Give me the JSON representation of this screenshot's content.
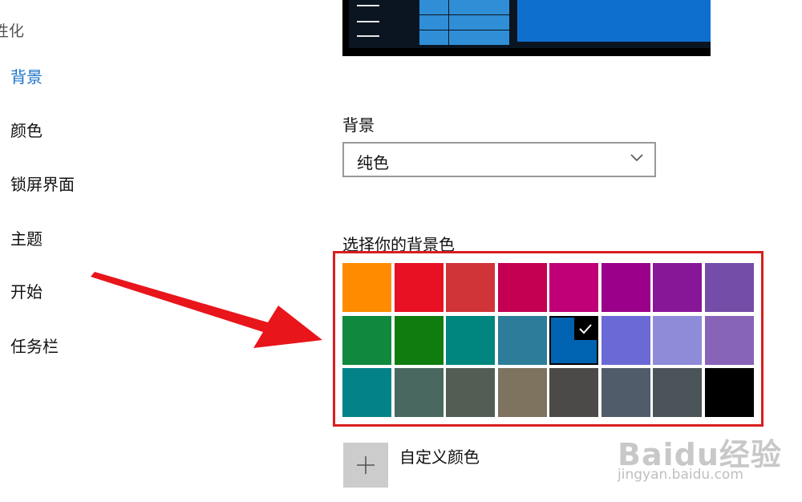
{
  "sidebar": {
    "section_title": "性化",
    "items": [
      {
        "label": "背景",
        "active": true
      },
      {
        "label": "颜色"
      },
      {
        "label": "锁屏界面"
      },
      {
        "label": "主题"
      },
      {
        "label": "开始"
      },
      {
        "label": "任务栏"
      }
    ]
  },
  "main": {
    "background_label": "背景",
    "background_dropdown": {
      "selected": "纯色",
      "icon": "chevron-down-icon"
    },
    "color_picker_label": "选择你的背景色",
    "palette": [
      [
        "#ff8c00",
        "#e81123",
        "#d13438",
        "#c30052",
        "#bf0077",
        "#9a0089",
        "#881798",
        "#744da9"
      ],
      [
        "#10893e",
        "#107c10",
        "#00867e",
        "#2d7d9a",
        "#0063b1",
        "#6b69d6",
        "#8e8cd8",
        "#8764b8"
      ],
      [
        "#038387",
        "#486860",
        "#525e54",
        "#7e735f",
        "#4c4a48",
        "#515c6b",
        "#4a5459",
        "#000000"
      ]
    ],
    "selected_color": "#0063b1",
    "custom_color_label": "自定义颜色"
  },
  "annotation": {
    "arrow_color": "#e8151b",
    "box_color": "#d81e1e"
  },
  "watermark": {
    "brand": "Baidu经验",
    "url": "jingyan.baidu.com"
  }
}
